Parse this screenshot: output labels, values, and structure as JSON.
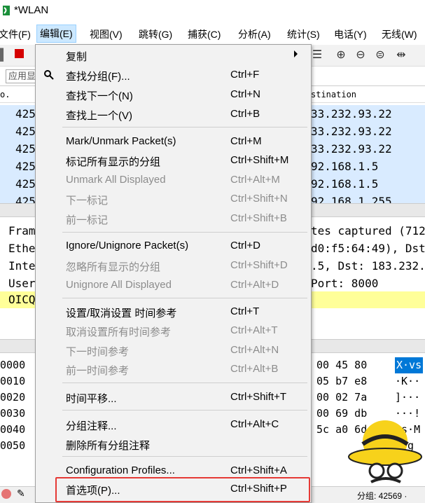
{
  "window": {
    "title": "*WLAN"
  },
  "menubar": [
    {
      "label": "文件(F)"
    },
    {
      "label": "编辑(E)"
    },
    {
      "label": "视图(V)"
    },
    {
      "label": "跳转(G)"
    },
    {
      "label": "捕获(C)"
    },
    {
      "label": "分析(A)"
    },
    {
      "label": "统计(S)"
    },
    {
      "label": "电话(Y)"
    },
    {
      "label": "无线(W)"
    }
  ],
  "filter": {
    "placeholder": "应用显"
  },
  "packet_list": {
    "header_no": "o.",
    "header_dest": "stination",
    "rows": [
      {
        "no": "425",
        "dest": "33.232.93.22"
      },
      {
        "no": "425",
        "dest": "33.232.93.22"
      },
      {
        "no": "425",
        "dest": "33.232.93.22"
      },
      {
        "no": "425",
        "dest": "92.168.1.5"
      },
      {
        "no": "425",
        "dest": "92.168.1.5"
      },
      {
        "no": "425",
        "dest": "92.168.1.255"
      }
    ]
  },
  "details": [
    {
      "left": "Fram",
      "right": "tes captured (712"
    },
    {
      "left": "Ethe",
      "right": "d0:f5:64:49), Dst"
    },
    {
      "left": "Inte",
      "right": ".5, Dst: 183.232."
    },
    {
      "left": "User",
      "right": "Port: 8000"
    },
    {
      "left": "OICQ",
      "right": ""
    }
  ],
  "bytes": [
    {
      "off": "0000",
      "hex": "00 45 80",
      "ascii": "X·vs"
    },
    {
      "off": "0010",
      "hex": "05 b7 e8",
      "ascii": "·K··"
    },
    {
      "off": "0020",
      "hex": "00 02 7a",
      "ascii": "]···"
    },
    {
      "off": "0030",
      "hex": "00 69 db",
      "ascii": "···!"
    },
    {
      "off": "0040",
      "hex": "5c a0 6d",
      "ascii": "·s·M"
    },
    {
      "off": "0050",
      "hex": "",
      "ascii": "M·g"
    }
  ],
  "statusbar": {
    "packets": "分组: 42569 ·"
  },
  "edit_menu": {
    "copy": {
      "label": "复制",
      "shortcut": ""
    },
    "find_packet": {
      "label": "查找分组(F)...",
      "shortcut": "Ctrl+F"
    },
    "find_next": {
      "label": "查找下一个(N)",
      "shortcut": "Ctrl+N"
    },
    "find_prev": {
      "label": "查找上一个(V)",
      "shortcut": "Ctrl+B"
    },
    "mark": {
      "label": "Mark/Unmark Packet(s)",
      "shortcut": "Ctrl+M"
    },
    "mark_all": {
      "label": "标记所有显示的分组",
      "shortcut": "Ctrl+Shift+M"
    },
    "unmark_all": {
      "label": "Unmark All Displayed",
      "shortcut": "Ctrl+Alt+M"
    },
    "next_mark": {
      "label": "下一标记",
      "shortcut": "Ctrl+Shift+N"
    },
    "prev_mark": {
      "label": "前一标记",
      "shortcut": "Ctrl+Shift+B"
    },
    "ignore": {
      "label": "Ignore/Unignore Packet(s)",
      "shortcut": "Ctrl+D"
    },
    "ignore_all": {
      "label": "忽略所有显示的分组",
      "shortcut": "Ctrl+Shift+D"
    },
    "unignore_all": {
      "label": "Unignore All Displayed",
      "shortcut": "Ctrl+Alt+D"
    },
    "set_time_ref": {
      "label": "设置/取消设置 时间参考",
      "shortcut": "Ctrl+T"
    },
    "unset_all_time_ref": {
      "label": "取消设置所有时间参考",
      "shortcut": "Ctrl+Alt+T"
    },
    "next_time_ref": {
      "label": "下一时间参考",
      "shortcut": "Ctrl+Alt+N"
    },
    "prev_time_ref": {
      "label": "前一时间参考",
      "shortcut": "Ctrl+Alt+B"
    },
    "time_shift": {
      "label": "时间平移...",
      "shortcut": "Ctrl+Shift+T"
    },
    "packet_comment": {
      "label": "分组注释...",
      "shortcut": "Ctrl+Alt+C"
    },
    "delete_comments": {
      "label": "删除所有分组注释",
      "shortcut": ""
    },
    "config_profiles": {
      "label": "Configuration Profiles...",
      "shortcut": "Ctrl+Shift+A"
    },
    "preferences": {
      "label": "首选项(P)...",
      "shortcut": "Ctrl+Shift+P"
    }
  },
  "colors": {
    "row_selected_bg": "#d9ebff",
    "highlight_red": "#e53935",
    "menu_bg": "#f2f2f2",
    "disabled_text": "#8c8c8c"
  }
}
